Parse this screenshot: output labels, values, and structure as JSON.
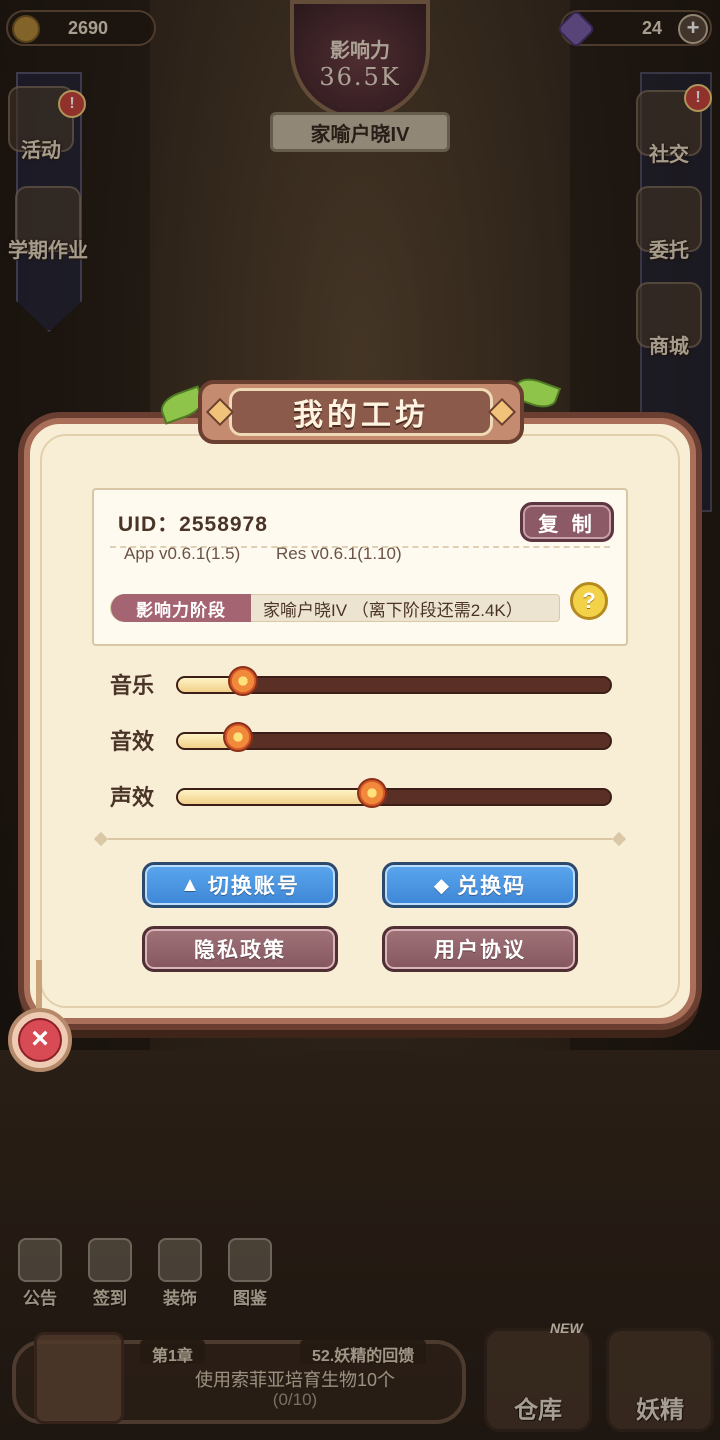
{
  "top_bar": {
    "coins": "2690",
    "gems": "24",
    "influence_label": "影响力",
    "influence_value": "36.5K",
    "rank": "家喻户晓IV"
  },
  "side_left": [
    "活动",
    "学期作业"
  ],
  "side_right": [
    "社交",
    "委托",
    "商城"
  ],
  "alert": "!",
  "dialog": {
    "title": "我的工坊",
    "uid": "UID：2558978",
    "copy_label": "复 制",
    "app_version": "App v0.6.1(1.5)",
    "res_version": "Res v0.6.1(1.10)",
    "stage_label": "影响力阶段",
    "stage_value": "家喻户晓IV （离下阶段还需2.4K）",
    "help_icon": "?",
    "sliders": [
      {
        "label": "音乐",
        "value": 0.15
      },
      {
        "label": "音效",
        "value": 0.14
      },
      {
        "label": "声效",
        "value": 0.45
      }
    ],
    "buttons": {
      "switch_account": "切换账号",
      "redeem_code": "兑换码",
      "privacy": "隐私政策",
      "agreement": "用户协议"
    },
    "close_icon": "×"
  },
  "bottom": {
    "icons": [
      "公告",
      "签到",
      "装饰",
      "图鉴"
    ],
    "chapter": "第1章",
    "task_title": "52.妖精的回馈",
    "task_desc": "使用索菲亚培育生物10个",
    "task_progress": "(0/10)",
    "new_tag": "NEW",
    "warehouse": "仓库",
    "fairy": "妖精"
  }
}
